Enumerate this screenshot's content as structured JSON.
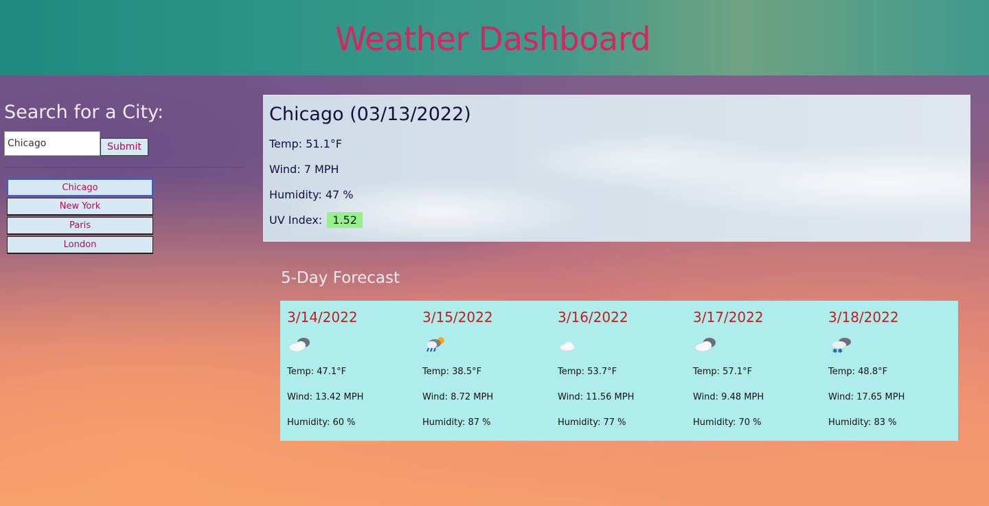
{
  "header": {
    "title": "Weather Dashboard"
  },
  "search": {
    "title": "Search for a City:",
    "input_value": "Chicago",
    "submit_label": "Submit"
  },
  "history": [
    {
      "label": "Chicago"
    },
    {
      "label": "New York"
    },
    {
      "label": "Paris"
    },
    {
      "label": "London"
    }
  ],
  "current": {
    "heading": "Chicago (03/13/2022)",
    "temp": "Temp: 51.1°F",
    "wind": "Wind: 7 MPH",
    "humidity": "Humidity: 47 %",
    "uv_label": "UV Index:",
    "uv_value": "1.52",
    "uv_color": "#98f08a"
  },
  "forecast": {
    "title": "5-Day Forecast",
    "days": [
      {
        "date": "3/14/2022",
        "icon": "cloud-icon",
        "temp": "Temp: 47.1°F",
        "wind": "Wind: 13.42 MPH",
        "humidity": "Humidity: 60 %"
      },
      {
        "date": "3/15/2022",
        "icon": "rain-sun-icon",
        "temp": "Temp: 38.5°F",
        "wind": "Wind: 8.72 MPH",
        "humidity": "Humidity: 87 %"
      },
      {
        "date": "3/16/2022",
        "icon": "light-cloud-icon",
        "temp": "Temp: 53.7°F",
        "wind": "Wind: 11.56 MPH",
        "humidity": "Humidity: 77 %"
      },
      {
        "date": "3/17/2022",
        "icon": "cloud-icon",
        "temp": "Temp: 57.1°F",
        "wind": "Wind: 9.48 MPH",
        "humidity": "Humidity: 70 %"
      },
      {
        "date": "3/18/2022",
        "icon": "snow-cloud-icon",
        "temp": "Temp: 48.8°F",
        "wind": "Wind: 17.65 MPH",
        "humidity": "Humidity: 83 %"
      }
    ]
  },
  "colors": {
    "title": "#d12860",
    "header_bg": "#2f9488",
    "forecast_bg": "#afecec",
    "forecast_date": "#c01e1e"
  }
}
